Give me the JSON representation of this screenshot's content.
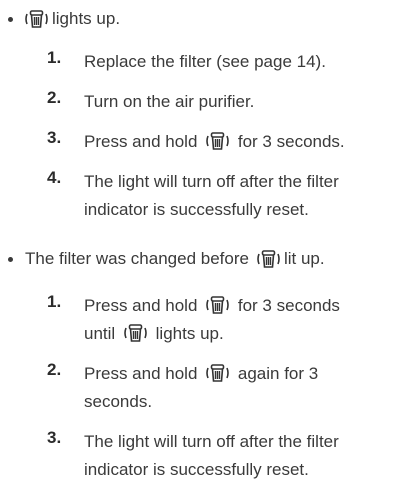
{
  "sections": [
    {
      "bullet_parts": [
        "",
        "lights up."
      ],
      "steps": [
        {
          "num": "1.",
          "lines": [
            [
              "Replace the filter (see page 14)."
            ]
          ]
        },
        {
          "num": "2.",
          "lines": [
            [
              "Turn on the air purifier."
            ]
          ]
        },
        {
          "num": "3.",
          "lines": [
            [
              "Press and hold",
              "for 3 seconds."
            ]
          ]
        },
        {
          "num": "4.",
          "lines": [
            [
              "The light will turn off after the filter"
            ],
            [
              "indicator is successfully reset."
            ]
          ]
        }
      ]
    },
    {
      "bullet_parts": [
        "The filter was changed before",
        "lit up."
      ],
      "steps": [
        {
          "num": "1.",
          "lines": [
            [
              "Press and hold",
              "for 3 seconds"
            ],
            [
              "until",
              "lights up."
            ]
          ]
        },
        {
          "num": "2.",
          "lines": [
            [
              "Press and hold",
              "again for 3"
            ],
            [
              "seconds."
            ]
          ]
        },
        {
          "num": "3.",
          "lines": [
            [
              "The light will turn off after the filter"
            ],
            [
              "indicator is successfully reset."
            ]
          ]
        }
      ]
    }
  ],
  "icon": "filter-reset-icon"
}
